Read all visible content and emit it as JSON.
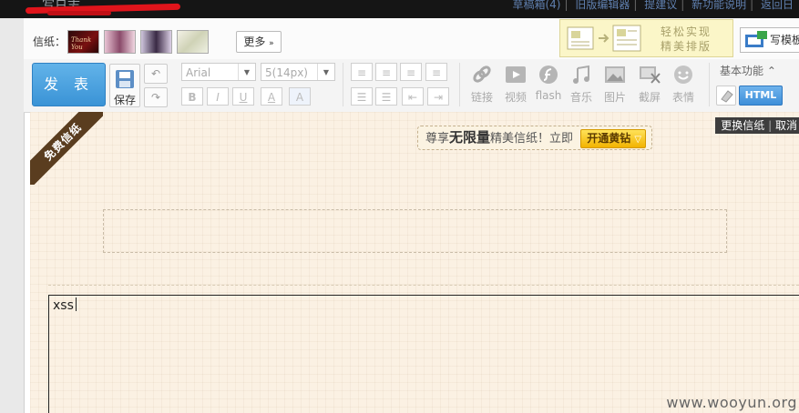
{
  "topbar": {
    "title": "写日志",
    "links": [
      "草稿箱(4)",
      "旧版编辑器",
      "提建议",
      "新功能说明",
      "返回日"
    ]
  },
  "papers": {
    "label": "信纸：",
    "thumbs": [
      "Thank You",
      "",
      "",
      ""
    ],
    "more_label": "更多",
    "promo_line1": "轻松实现",
    "promo_line2": "精美排版",
    "write_template_label": "写模板"
  },
  "toolbar": {
    "publish_label": "发 表",
    "save_label": "保存",
    "font_family": "Arial",
    "font_size": "5(14px)",
    "tools": [
      {
        "label": "链接",
        "icon": "link-icon"
      },
      {
        "label": "视频",
        "icon": "video-icon"
      },
      {
        "label": "flash",
        "icon": "flash-icon"
      },
      {
        "label": "音乐",
        "icon": "music-icon"
      },
      {
        "label": "图片",
        "icon": "image-icon"
      },
      {
        "label": "截屏",
        "icon": "screenshot-icon"
      },
      {
        "label": "表情",
        "icon": "emoticon-icon"
      }
    ],
    "basic_label": "基本功能",
    "html_label": "HTML"
  },
  "paper": {
    "ribbon": "免费信纸",
    "change_paper": "更换信纸",
    "cancel": "取消",
    "enjoy_pre": "尊享",
    "enjoy_bold": "无限量",
    "enjoy_post": "精美信纸！立即",
    "vip_button": "开通黄钻"
  },
  "editor": {
    "content": "xss"
  },
  "watermark": "www.wooyun.org",
  "colors": {
    "publish": "#3a93d6",
    "ribbon": "#5a3d1f",
    "paper_bg": "#fbf1e3",
    "vip": "#f2b300"
  }
}
